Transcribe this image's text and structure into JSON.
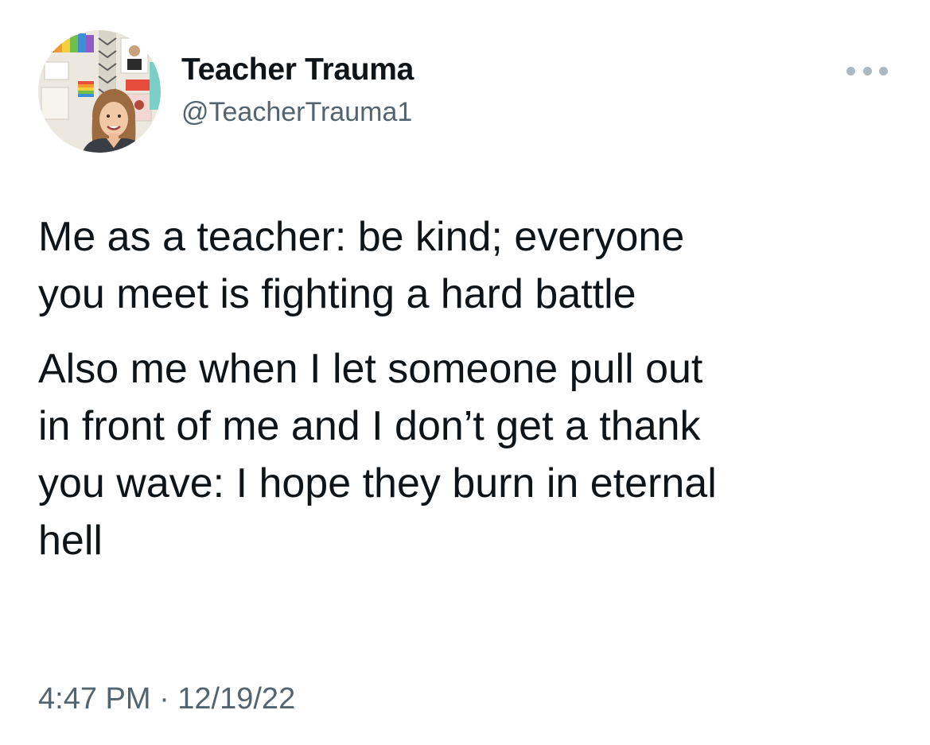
{
  "author": {
    "display_name": "Teacher Trauma",
    "handle": "@TeacherTrauma1",
    "avatar_description": "profile-photo"
  },
  "menu": {
    "icon": "more-horizontal-icon"
  },
  "tweet": {
    "paragraph_1": "Me as a teacher: be kind; everyone\nyou meet is fighting a hard battle",
    "paragraph_2": "Also me when I let someone pull out\nin front of me and I don’t get a thank\nyou wave: I hope they burn in eternal\nhell",
    "timestamp": "4:47 PM · 12/19/22"
  },
  "colors": {
    "text_primary": "#0f1419",
    "text_secondary": "#536471",
    "menu_dots": "#aab8c2",
    "background": "#ffffff"
  }
}
